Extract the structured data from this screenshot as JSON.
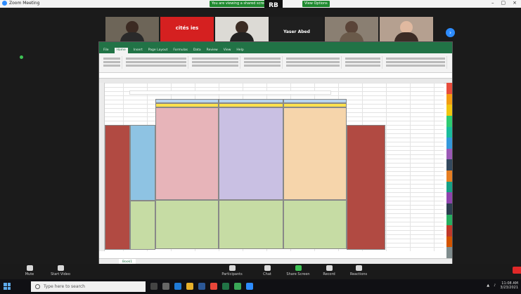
{
  "window": {
    "title": "Zoom Meeting"
  },
  "banner": {
    "recording": "You are viewing a shared screen",
    "view_options": "View Options"
  },
  "participants": [
    {
      "name": "",
      "bg": "#6d6558",
      "skin": "#3b2a22",
      "shirt": "#2a2a2a"
    },
    {
      "name": "",
      "brand": "cités ies",
      "bg": "#d52020",
      "skin": "#4a3a33",
      "shirt": "#2d2d2d"
    },
    {
      "name": "",
      "bg": "#dcdad5",
      "skin": "#3a2b23",
      "shirt": "#222"
    },
    {
      "name": "Yaser Abed",
      "bg": "#1f1f1f"
    },
    {
      "name": "",
      "bg": "#8a7f72",
      "skin": "#5a4438",
      "shirt": "#6a5a4a"
    },
    {
      "name": "",
      "bg": "#b5a090",
      "skin": "#e0b9a0",
      "shirt": "#3b2b25"
    }
  ],
  "excel": {
    "tabs": [
      "File",
      "Home",
      "Insert",
      "Page Layout",
      "Formulas",
      "Data",
      "Review",
      "View",
      "Help"
    ],
    "active_tab": "Home",
    "sheet_tab": "Book1",
    "colors": {
      "green": "#217346"
    }
  },
  "controls": [
    "Mute",
    "Start Video",
    "Participants",
    "Chat",
    "Share Screen",
    "Record",
    "Reactions"
  ],
  "taskbar": {
    "search_placeholder": "Type here to search",
    "time": "11:08 AM",
    "date": "3/23/2021"
  }
}
